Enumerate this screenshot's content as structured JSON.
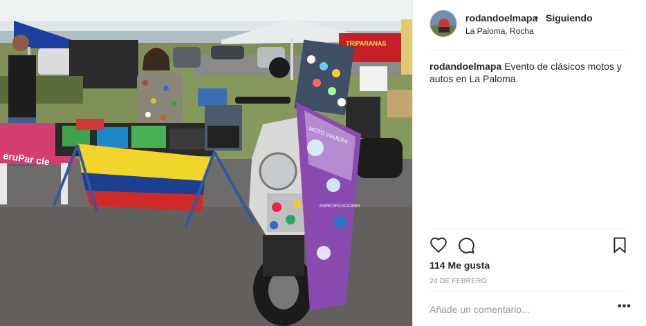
{
  "post": {
    "username": "rodandoelmapa",
    "separator": "•",
    "follow_status": "Siguiendo",
    "location": "La Paloma, Rocha",
    "caption_text": "Evento de clásicos motos y autos en La Paloma.",
    "likes": "114 Me gusta",
    "date": "24 DE FEBRERO",
    "comment_placeholder": "Añade un comentario...",
    "more_label": "•••"
  },
  "photo": {
    "banner_text": "TRIPARANAS",
    "table_cloth_text": "eruPar cle",
    "poster_title": "MOTO VIAJERA",
    "poster_heading": "ESPECIFICACIONES"
  },
  "icons": {
    "like": "heart-icon",
    "comment": "comment-bubble-icon",
    "save": "bookmark-icon",
    "options": "more-options-icon"
  },
  "colors": {
    "text": "#262626",
    "muted": "#8e8e8e",
    "divider": "#efefef",
    "placeholder": "#999999"
  }
}
